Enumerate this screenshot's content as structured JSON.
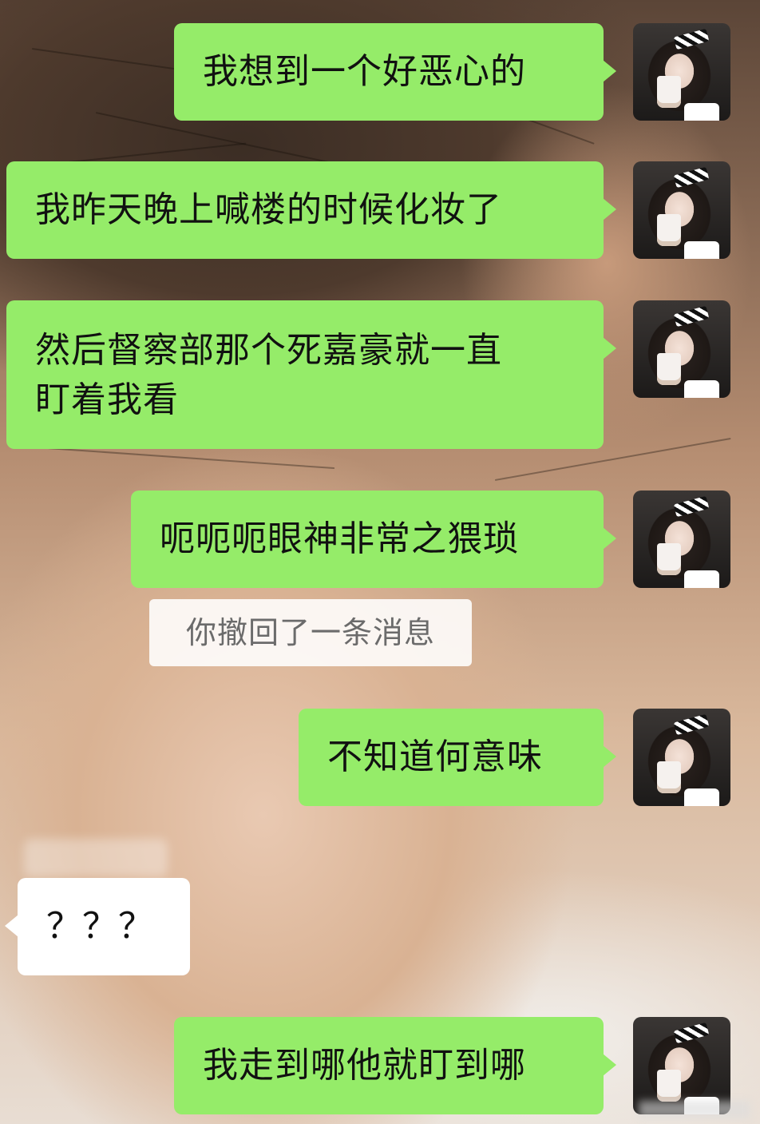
{
  "chat": {
    "messages": [
      {
        "side": "right",
        "lines": [
          "我想到一个好恶心的"
        ]
      },
      {
        "side": "right",
        "lines": [
          "我昨天晚上喊楼的时候化妆了"
        ]
      },
      {
        "side": "right",
        "lines": [
          "然后督察部那个死嘉豪就一直",
          "盯着我看"
        ]
      },
      {
        "side": "right",
        "lines": [
          "呃呃呃眼神非常之猥琐"
        ]
      },
      {
        "side": "right",
        "lines": [
          "不知道何意味"
        ]
      },
      {
        "side": "left",
        "lines": [
          "？？？"
        ]
      },
      {
        "side": "right",
        "lines": [
          "我走到哪他就盯到哪"
        ]
      }
    ],
    "system_notice": "你撤回了一条消息"
  },
  "colors": {
    "outgoing_bubble": "#95ec69",
    "incoming_bubble": "#ffffff",
    "notice_text": "#6b6b6b"
  },
  "icons": {
    "avatar": "user-avatar-photo"
  }
}
